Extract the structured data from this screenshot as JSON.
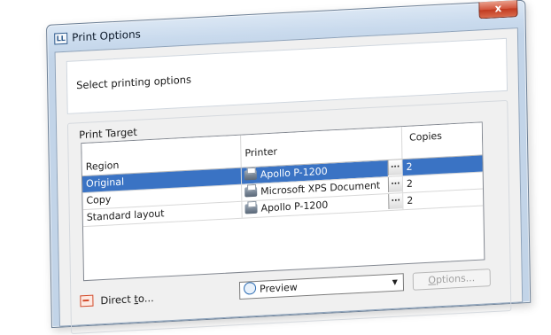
{
  "window": {
    "title": "Print Options",
    "app_icon_label": "LL",
    "close_label": "x"
  },
  "header": {
    "subtitle": "Select printing options"
  },
  "print_target": {
    "group_label": "Print Target",
    "columns": {
      "region": "Region",
      "printer": "Printer",
      "copies": "Copies"
    },
    "rows": [
      {
        "region": "Original",
        "printer": "Apollo P-1200",
        "copies": "2",
        "selected": true
      },
      {
        "region": "Copy",
        "printer": "Microsoft XPS Document",
        "copies": "2",
        "selected": false
      },
      {
        "region": "Standard layout",
        "printer": "Apollo P-1200",
        "copies": "2",
        "selected": false
      }
    ],
    "ellipsis_label": "..."
  },
  "footer": {
    "direct_to_label_prefix": "Direct ",
    "direct_to_label_underlined": "t",
    "direct_to_label_suffix": "o...",
    "preview_value": "Preview",
    "options_label_prefix": "",
    "options_label_underlined": "O",
    "options_label_suffix": "ptions..."
  },
  "colors": {
    "selection": "#3a73c4",
    "titlebar": "#c9daed",
    "close_button": "#c13a20"
  }
}
